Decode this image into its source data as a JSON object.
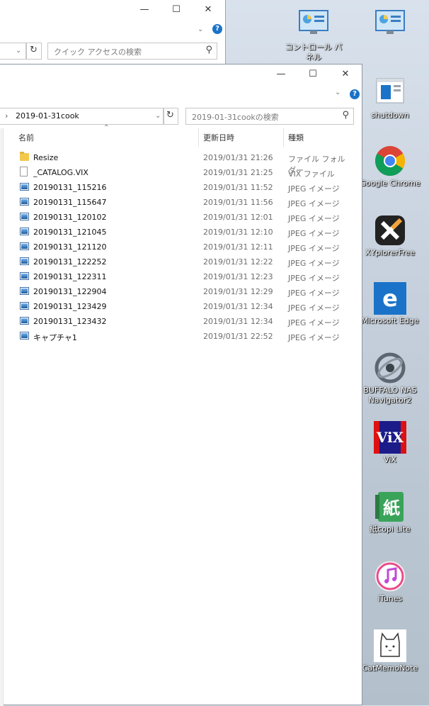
{
  "desktop": {
    "icons": [
      {
        "label": "コントロール パネル"
      },
      {
        "label": ""
      },
      {
        "label": "shutdown"
      },
      {
        "label": "Google Chrome"
      },
      {
        "label": "XYplorerFree"
      },
      {
        "label": "Microsoft Edge"
      },
      {
        "label": "BUFFALO NAS\nNavigator2"
      },
      {
        "label": "ViX"
      },
      {
        "label": "紙copi Lite"
      },
      {
        "label": "iTunes"
      },
      {
        "label": "CatMemoNote"
      }
    ]
  },
  "back_window": {
    "search_placeholder": "クイック アクセスの検索",
    "help": "?"
  },
  "front_window": {
    "address": "2019-01-31cook",
    "search_placeholder": "2019-01-31cookの検索",
    "help": "?",
    "columns": {
      "name": "名前",
      "date": "更新日時",
      "type": "種類"
    },
    "files": [
      {
        "icon": "folder-icon",
        "name": "Resize",
        "date": "2019/01/31 21:26",
        "type": "ファイル フォルダー"
      },
      {
        "icon": "document-icon",
        "name": "_CATALOG.VIX",
        "date": "2019/01/31 21:25",
        "type": "VIX ファイル"
      },
      {
        "icon": "image-icon",
        "name": "20190131_115216",
        "date": "2019/01/31 11:52",
        "type": "JPEG イメージ"
      },
      {
        "icon": "image-icon",
        "name": "20190131_115647",
        "date": "2019/01/31 11:56",
        "type": "JPEG イメージ"
      },
      {
        "icon": "image-icon",
        "name": "20190131_120102",
        "date": "2019/01/31 12:01",
        "type": "JPEG イメージ"
      },
      {
        "icon": "image-icon",
        "name": "20190131_121045",
        "date": "2019/01/31 12:10",
        "type": "JPEG イメージ"
      },
      {
        "icon": "image-icon",
        "name": "20190131_121120",
        "date": "2019/01/31 12:11",
        "type": "JPEG イメージ"
      },
      {
        "icon": "image-icon",
        "name": "20190131_122252",
        "date": "2019/01/31 12:22",
        "type": "JPEG イメージ"
      },
      {
        "icon": "image-icon",
        "name": "20190131_122311",
        "date": "2019/01/31 12:23",
        "type": "JPEG イメージ"
      },
      {
        "icon": "image-icon",
        "name": "20190131_122904",
        "date": "2019/01/31 12:29",
        "type": "JPEG イメージ"
      },
      {
        "icon": "image-icon",
        "name": "20190131_123429",
        "date": "2019/01/31 12:34",
        "type": "JPEG イメージ"
      },
      {
        "icon": "image-icon",
        "name": "20190131_123432",
        "date": "2019/01/31 12:34",
        "type": "JPEG イメージ"
      },
      {
        "icon": "image-icon",
        "name": "キャプチャ1",
        "date": "2019/01/31 22:52",
        "type": "JPEG イメージ"
      }
    ]
  }
}
